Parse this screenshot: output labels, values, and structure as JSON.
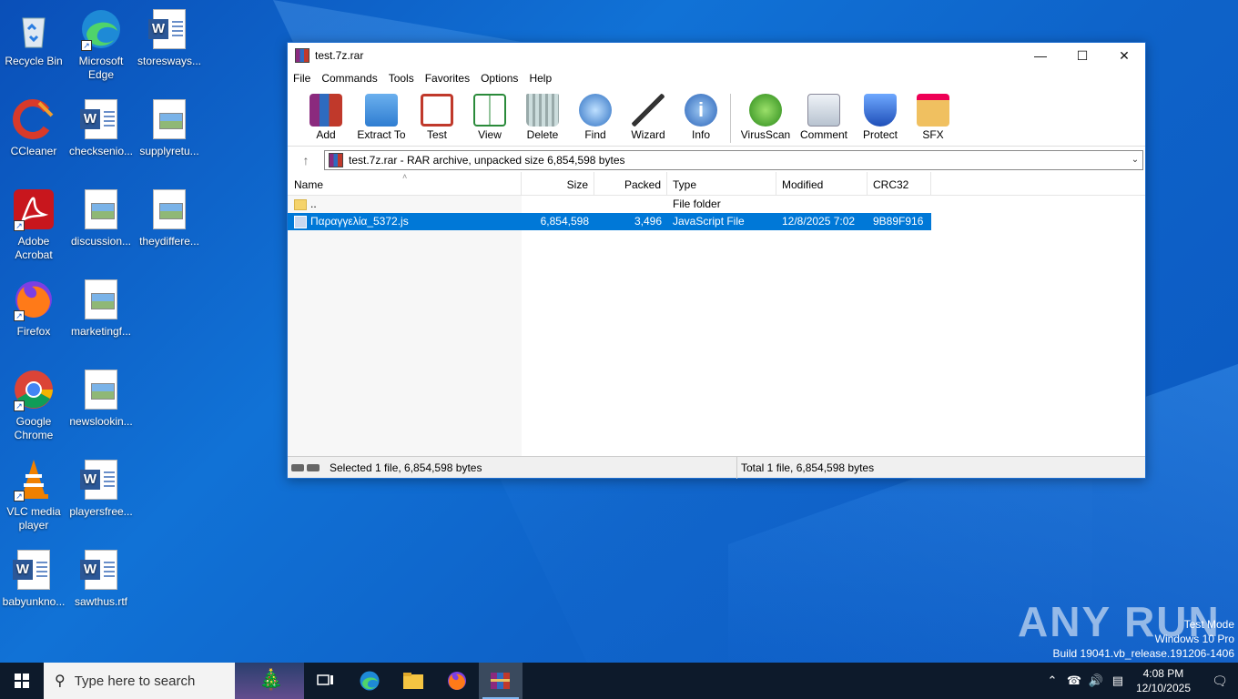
{
  "desktop": {
    "icons": [
      {
        "label": "Recycle Bin"
      },
      {
        "label": "Microsoft Edge"
      },
      {
        "label": "storesways..."
      },
      {
        "label": "CCleaner"
      },
      {
        "label": "checksenio..."
      },
      {
        "label": "supplyretu..."
      },
      {
        "label": "Adobe Acrobat"
      },
      {
        "label": "discussion..."
      },
      {
        "label": "theydiffere..."
      },
      {
        "label": "Firefox"
      },
      {
        "label": "marketingf..."
      },
      {
        "label": "Google Chrome"
      },
      {
        "label": "newslookin..."
      },
      {
        "label": "VLC media player"
      },
      {
        "label": "playersfree..."
      },
      {
        "label": "babyunkno..."
      },
      {
        "label": "sawthus.rtf"
      }
    ]
  },
  "window": {
    "title": "test.7z.rar",
    "menu": [
      "File",
      "Commands",
      "Tools",
      "Favorites",
      "Options",
      "Help"
    ],
    "toolbar": [
      {
        "label": "Add",
        "icon": "add-archive-icon"
      },
      {
        "label": "Extract To",
        "icon": "extract-folder-icon"
      },
      {
        "label": "Test",
        "icon": "test-clipboard-icon"
      },
      {
        "label": "View",
        "icon": "book-view-icon"
      },
      {
        "label": "Delete",
        "icon": "trash-icon"
      },
      {
        "label": "Find",
        "icon": "magnifier-icon"
      },
      {
        "label": "Wizard",
        "icon": "magic-wand-icon"
      },
      {
        "label": "Info",
        "icon": "info-icon"
      },
      {
        "label": "VirusScan",
        "icon": "virus-scan-icon"
      },
      {
        "label": "Comment",
        "icon": "comment-icon"
      },
      {
        "label": "Protect",
        "icon": "shield-icon"
      },
      {
        "label": "SFX",
        "icon": "sfx-box-icon"
      }
    ],
    "address": "test.7z.rar - RAR archive, unpacked size 6,854,598 bytes",
    "columns": [
      "Name",
      "Size",
      "Packed",
      "Type",
      "Modified",
      "CRC32"
    ],
    "rows": [
      {
        "name": "..",
        "size": "",
        "packed": "",
        "type": "File folder",
        "modified": "",
        "crc": ""
      },
      {
        "name": "Παραγγελία_5372.js",
        "size": "6,854,598",
        "packed": "3,496",
        "type": "JavaScript File",
        "modified": "12/8/2025 7:02 ...",
        "crc": "9B89F916"
      }
    ],
    "status_left": "Selected 1 file, 6,854,598 bytes",
    "status_right": "Total 1 file, 6,854,598 bytes"
  },
  "watermark": {
    "brand": "ANY RUN",
    "line1": "Test Mode",
    "line2": "Windows 10 Pro",
    "line3": "Build 19041.vb_release.191206-1406"
  },
  "taskbar": {
    "search_placeholder": "Type here to search",
    "time": "4:08 PM",
    "date": "12/10/2025"
  },
  "colors": {
    "selection": "#0078d7",
    "taskbar": "#0d1a2b",
    "desktop": "#0e63c9"
  }
}
